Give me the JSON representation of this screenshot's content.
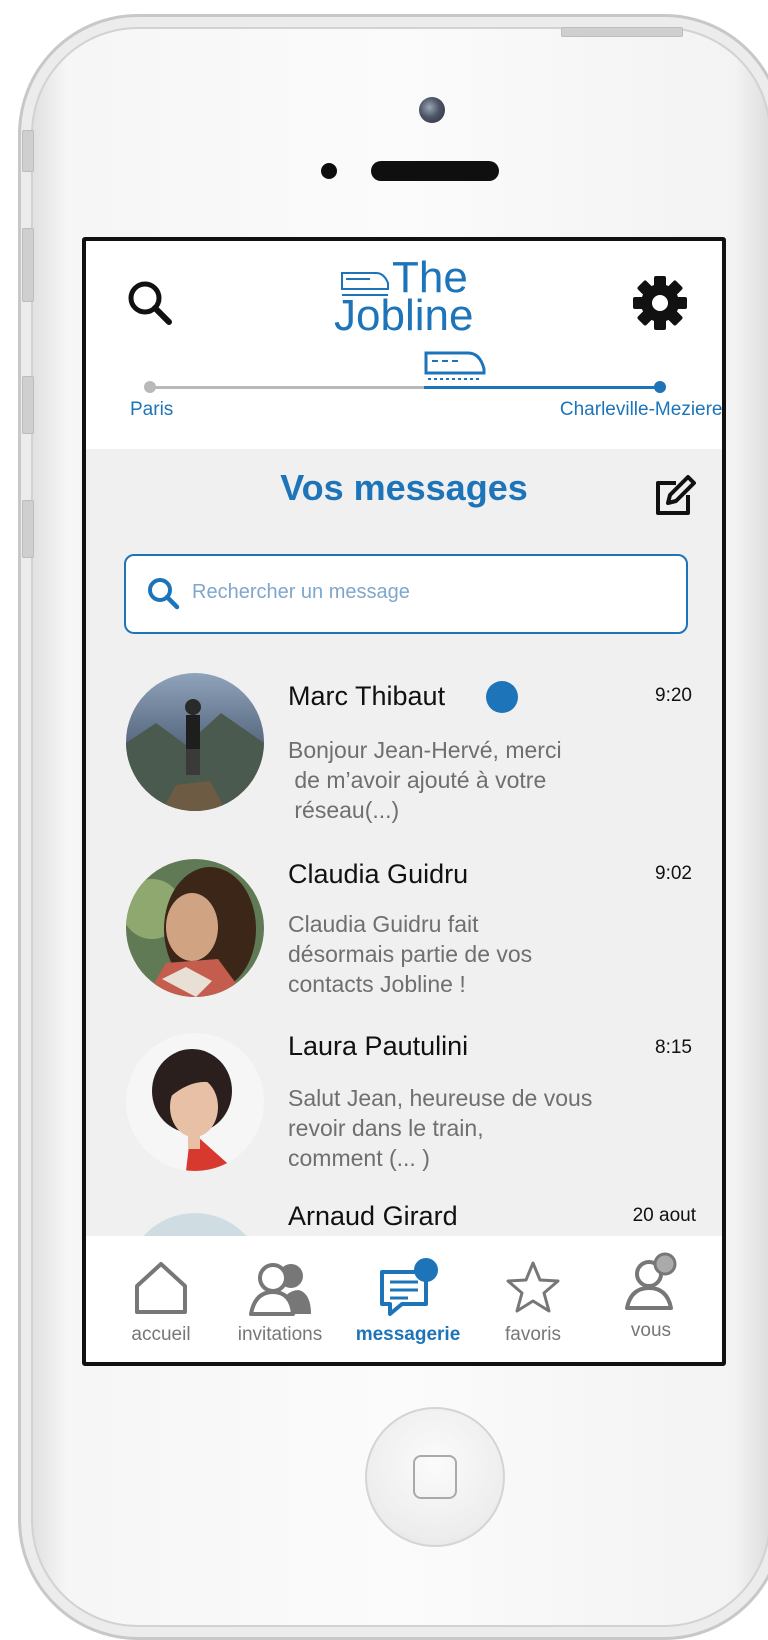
{
  "app": {
    "logo_line1": "The",
    "logo_line2": "Jobline"
  },
  "route": {
    "from": "Paris",
    "to": "Charleville-Mezieres",
    "progress": 0.52
  },
  "page": {
    "title": "Vos messages"
  },
  "search": {
    "placeholder": "Rechercher un message"
  },
  "messages": [
    {
      "name": "Marc Thibaut",
      "time": "9:20",
      "preview_lines": [
        "Bonjour Jean-Hervé, merci",
        " de m’avoir ajouté à votre",
        " réseau(...)"
      ],
      "unread": true
    },
    {
      "name": "Claudia Guidru",
      "time": "9:02",
      "preview_lines": [
        "Claudia Guidru fait",
        "désormais partie de vos",
        "contacts Jobline !"
      ],
      "unread": false
    },
    {
      "name": "Laura Pautulini",
      "time": "8:15",
      "preview_lines": [
        "Salut Jean, heureuse de vous",
        "revoir dans le train,",
        "comment (... )"
      ],
      "unread": false
    },
    {
      "name": "Arnaud Girard",
      "time": "20 aout",
      "preview_lines": [],
      "unread": false
    }
  ],
  "tabs": [
    {
      "label": "accueil",
      "icon": "home-icon",
      "active": false
    },
    {
      "label": "invitations",
      "icon": "contacts-icon",
      "active": false
    },
    {
      "label": "messagerie",
      "icon": "chat-icon",
      "active": true
    },
    {
      "label": "favoris",
      "icon": "star-icon",
      "active": false
    },
    {
      "label": "vous",
      "icon": "user-icon",
      "active": false
    }
  ],
  "colors": {
    "accent": "#1d74b8",
    "background": "#f0f0f0",
    "muted_text": "#6f6f6f"
  }
}
